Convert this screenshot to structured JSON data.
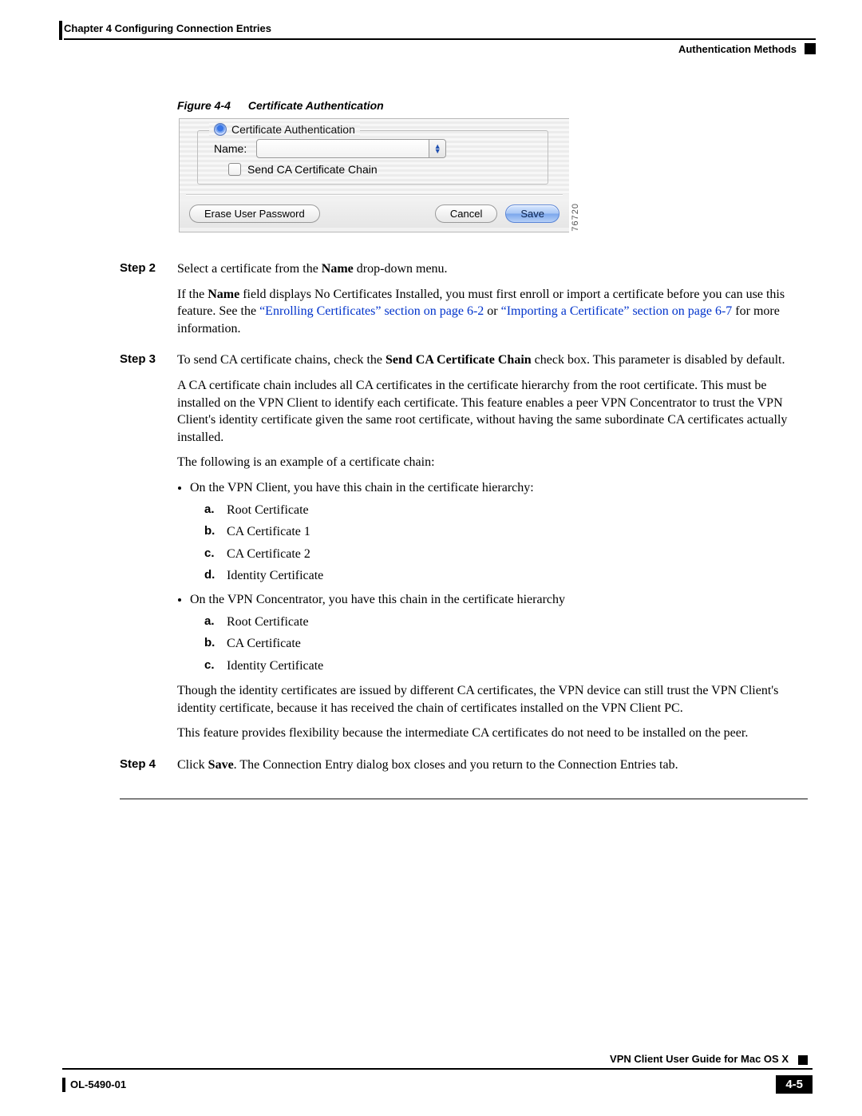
{
  "header": {
    "chapter": "Chapter 4    Configuring Connection Entries",
    "section": "Authentication Methods"
  },
  "figure": {
    "label": "Figure 4-4",
    "title": "Certificate Authentication",
    "radio_label": "Certificate Authentication",
    "name_label": "Name:",
    "chain_label": "Send CA Certificate Chain",
    "btn_erase": "Erase User Password",
    "btn_cancel": "Cancel",
    "btn_save": "Save",
    "id": "76720"
  },
  "steps": {
    "s2": {
      "label": "Step 2",
      "p1a": "Select a certificate from the ",
      "p1b": "Name",
      "p1c": " drop-down menu.",
      "p2a": "If the ",
      "p2b": "Name",
      "p2c": " field displays No Certificates Installed, you must first enroll or import a certificate before you can use this feature. See the ",
      "link1": "“Enrolling Certificates” section on page 6-2",
      "p2d": " or ",
      "link2": "“Importing a Certificate” section on page 6-7",
      "p2e": " for more information."
    },
    "s3": {
      "label": "Step 3",
      "p1a": "To send CA certificate chains, check the ",
      "p1b": "Send CA Certificate Chain",
      "p1c": " check box. This parameter is disabled by default.",
      "p2": "A CA certificate chain includes all CA certificates in the certificate hierarchy from the root certificate. This must be installed on the VPN Client to identify each certificate. This feature enables a peer VPN Concentrator to trust the VPN Client's identity certificate given the same root certificate, without having the same subordinate CA certificates actually installed.",
      "p3": "The following is an example of a certificate chain:",
      "b1": "On the VPN Client, you have this chain in the certificate hierarchy:",
      "b1a": "Root Certificate",
      "b1b": "CA Certificate 1",
      "b1c": "CA Certificate 2",
      "b1d": "Identity Certificate",
      "b2": "On the VPN Concentrator, you have this chain in the certificate hierarchy",
      "b2a": "Root Certificate",
      "b2b": "CA Certificate",
      "b2c": "Identity Certificate",
      "p4": "Though the identity certificates are issued by different CA certificates, the VPN device can still trust the VPN Client's identity certificate, because it has received the chain of certificates installed on the VPN Client PC.",
      "p5": "This feature provides flexibility because the intermediate CA certificates do not need to be installed on the peer."
    },
    "s4": {
      "label": "Step 4",
      "p1a": "Click ",
      "p1b": "Save",
      "p1c": ". The Connection Entry dialog box closes and you return to the Connection Entries tab."
    }
  },
  "footer": {
    "guide": "VPN Client User Guide for Mac OS X",
    "doc": "OL-5490-01",
    "page": "4-5"
  },
  "letters": {
    "a": "a.",
    "b": "b.",
    "c": "c.",
    "d": "d."
  }
}
